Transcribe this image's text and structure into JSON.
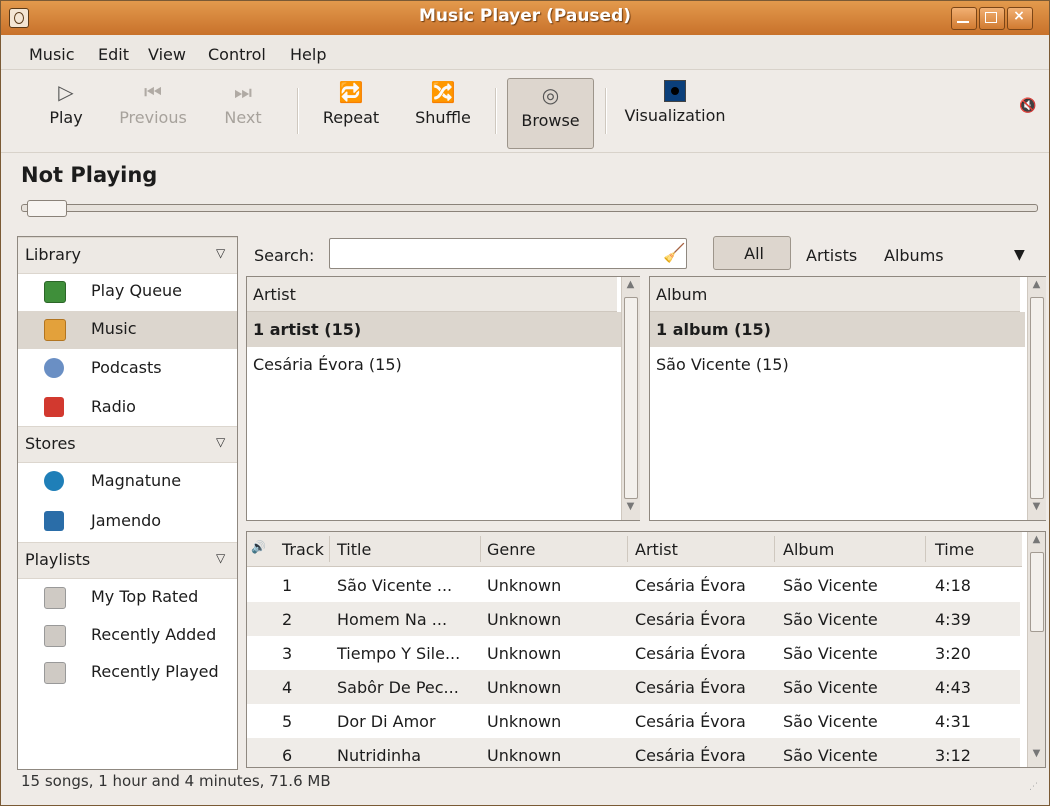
{
  "window": {
    "title": "Music Player (Paused)"
  },
  "menu": [
    "Music",
    "Edit",
    "View",
    "Control",
    "Help"
  ],
  "toolbar": {
    "play": "Play",
    "previous": "Previous",
    "next": "Next",
    "repeat": "Repeat",
    "shuffle": "Shuffle",
    "browse": "Browse",
    "visualization": "Visualization"
  },
  "now_playing": "Not Playing",
  "sidebar": {
    "library_header": "Library",
    "library": [
      "Play Queue",
      "Music",
      "Podcasts",
      "Radio"
    ],
    "stores_header": "Stores",
    "stores": [
      "Magnatune",
      "Jamendo"
    ],
    "playlists_header": "Playlists",
    "playlists": [
      "My Top Rated",
      "Recently Added",
      "Recently Played"
    ]
  },
  "search": {
    "label": "Search:",
    "value": ""
  },
  "filters": {
    "all": "All",
    "artists": "Artists",
    "albums": "Albums"
  },
  "artist_pane": {
    "header": "Artist",
    "summary": "1 artist (15)",
    "items": [
      "Cesária Évora (15)"
    ]
  },
  "album_pane": {
    "header": "Album",
    "summary": "1 album (15)",
    "items": [
      "São Vicente (15)"
    ]
  },
  "tracks": {
    "columns": {
      "track": "Track",
      "title": "Title",
      "genre": "Genre",
      "artist": "Artist",
      "album": "Album",
      "time": "Time"
    },
    "rows": [
      {
        "track": "1",
        "title": "São Vicente ...",
        "genre": "Unknown",
        "artist": "Cesária Évora",
        "album": "São Vicente",
        "time": "4:18"
      },
      {
        "track": "2",
        "title": "Homem Na ...",
        "genre": "Unknown",
        "artist": "Cesária Évora",
        "album": "São Vicente",
        "time": "4:39"
      },
      {
        "track": "3",
        "title": "Tiempo Y Sile...",
        "genre": "Unknown",
        "artist": "Cesária Évora",
        "album": "São Vicente",
        "time": "3:20"
      },
      {
        "track": "4",
        "title": "Sabôr De Pec...",
        "genre": "Unknown",
        "artist": "Cesária Évora",
        "album": "São Vicente",
        "time": "4:43"
      },
      {
        "track": "5",
        "title": "Dor Di Amor",
        "genre": "Unknown",
        "artist": "Cesária Évora",
        "album": "São Vicente",
        "time": "4:31"
      },
      {
        "track": "6",
        "title": "Nutridinha",
        "genre": "Unknown",
        "artist": "Cesária Évora",
        "album": "São Vicente",
        "time": "3:12"
      }
    ]
  },
  "status": "15 songs, 1 hour and 4 minutes, 71.6 MB",
  "colors": {
    "titlebar": "#d6823a",
    "selection": "#dcd6ce",
    "window_bg": "#efebe7"
  }
}
